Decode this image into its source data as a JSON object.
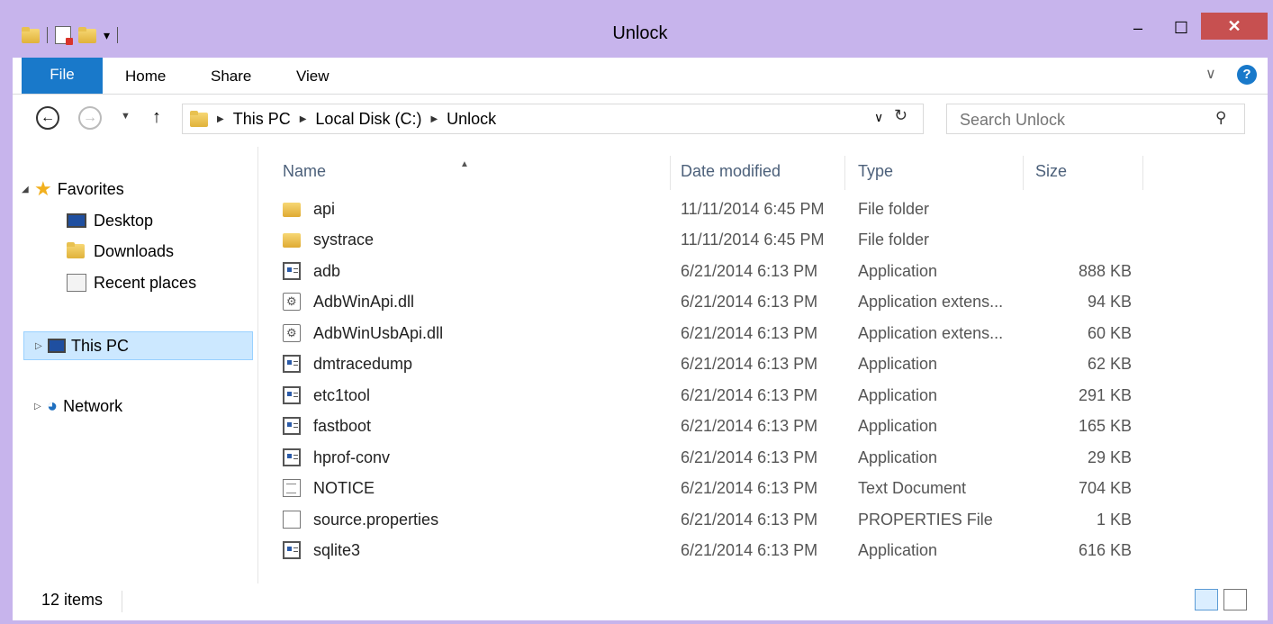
{
  "window": {
    "title": "Unlock"
  },
  "controls": {
    "minimize": "–",
    "maximize": "☐",
    "close": "✕"
  },
  "ribbon": {
    "tabs": [
      {
        "label": "File"
      },
      {
        "label": "Home"
      },
      {
        "label": "Share"
      },
      {
        "label": "View"
      }
    ],
    "help": "?"
  },
  "address": {
    "breadcrumbs": [
      "This PC",
      "Local Disk (C:)",
      "Unlock"
    ]
  },
  "search": {
    "placeholder": "Search Unlock"
  },
  "navpane": {
    "favorites": "Favorites",
    "favorites_items": [
      "Desktop",
      "Downloads",
      "Recent places"
    ],
    "this_pc": "This PC",
    "network": "Network"
  },
  "columns": {
    "name": "Name",
    "date": "Date modified",
    "type": "Type",
    "size": "Size"
  },
  "files": [
    {
      "icon": "folder-icon",
      "name": "api",
      "date": "11/11/2014 6:45 PM",
      "type": "File folder",
      "size": ""
    },
    {
      "icon": "folder-icon",
      "name": "systrace",
      "date": "11/11/2014 6:45 PM",
      "type": "File folder",
      "size": ""
    },
    {
      "icon": "application-icon",
      "name": "adb",
      "date": "6/21/2014 6:13 PM",
      "type": "Application",
      "size": "888 KB"
    },
    {
      "icon": "dll-icon",
      "name": "AdbWinApi.dll",
      "date": "6/21/2014 6:13 PM",
      "type": "Application extens...",
      "size": "94 KB"
    },
    {
      "icon": "dll-icon",
      "name": "AdbWinUsbApi.dll",
      "date": "6/21/2014 6:13 PM",
      "type": "Application extens...",
      "size": "60 KB"
    },
    {
      "icon": "application-icon",
      "name": "dmtracedump",
      "date": "6/21/2014 6:13 PM",
      "type": "Application",
      "size": "62 KB"
    },
    {
      "icon": "application-icon",
      "name": "etc1tool",
      "date": "6/21/2014 6:13 PM",
      "type": "Application",
      "size": "291 KB"
    },
    {
      "icon": "application-icon",
      "name": "fastboot",
      "date": "6/21/2014 6:13 PM",
      "type": "Application",
      "size": "165 KB"
    },
    {
      "icon": "application-icon",
      "name": "hprof-conv",
      "date": "6/21/2014 6:13 PM",
      "type": "Application",
      "size": "29 KB"
    },
    {
      "icon": "text-document-icon",
      "name": "NOTICE",
      "date": "6/21/2014 6:13 PM",
      "type": "Text Document",
      "size": "704 KB"
    },
    {
      "icon": "blank-file-icon",
      "name": "source.properties",
      "date": "6/21/2014 6:13 PM",
      "type": "PROPERTIES File",
      "size": "1 KB"
    },
    {
      "icon": "application-icon",
      "name": "sqlite3",
      "date": "6/21/2014 6:13 PM",
      "type": "Application",
      "size": "616 KB"
    }
  ],
  "status": {
    "count": "12 items"
  }
}
